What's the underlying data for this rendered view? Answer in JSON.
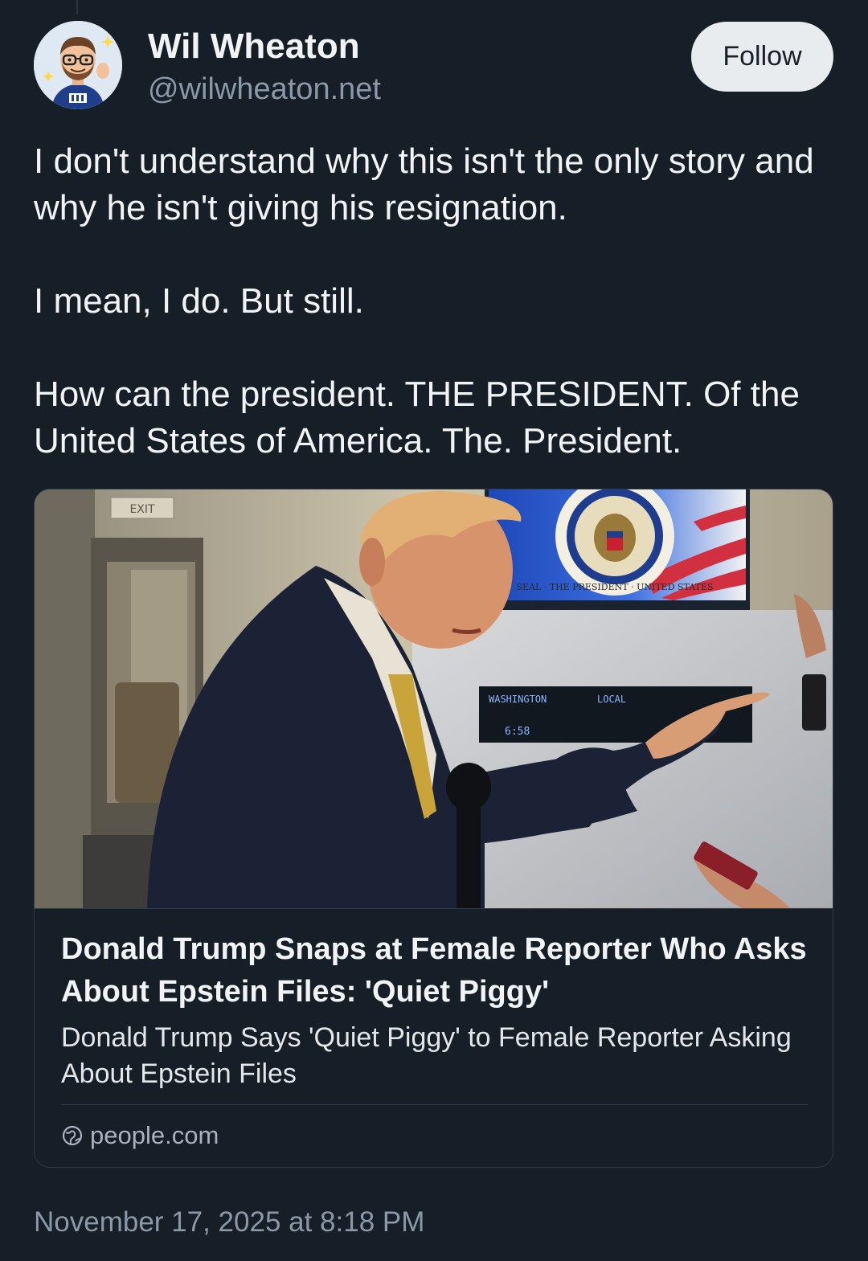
{
  "author": {
    "display_name": "Wil Wheaton",
    "handle": "@wilwheaton.net",
    "avatar": "cartoon-avatar"
  },
  "follow_label": "Follow",
  "post": {
    "paragraphs": [
      "I don't understand why this isn't the only story and why he isn't giving his resignation.",
      "I mean, I do. But still.",
      "How can the president. THE PRESIDENT. Of the United States of America. The. President."
    ]
  },
  "embed": {
    "image_texts": {
      "exit_sign": "EXIT",
      "clock_city": "WASHINGTON",
      "clock_local": "LOCAL",
      "clock_time": "6:58",
      "seal_text": "SEAL · THE PRESIDENT · UNITED STATES"
    },
    "title": "Donald Trump Snaps at Female Reporter Who Asks About Epstein Files: 'Quiet Piggy'",
    "description": "Donald Trump Says 'Quiet Piggy' to Female Reporter Asking About Epstein Files",
    "source": "people.com",
    "source_icon": "globe-icon"
  },
  "timestamp": "November 17, 2025 at 8:18 PM"
}
